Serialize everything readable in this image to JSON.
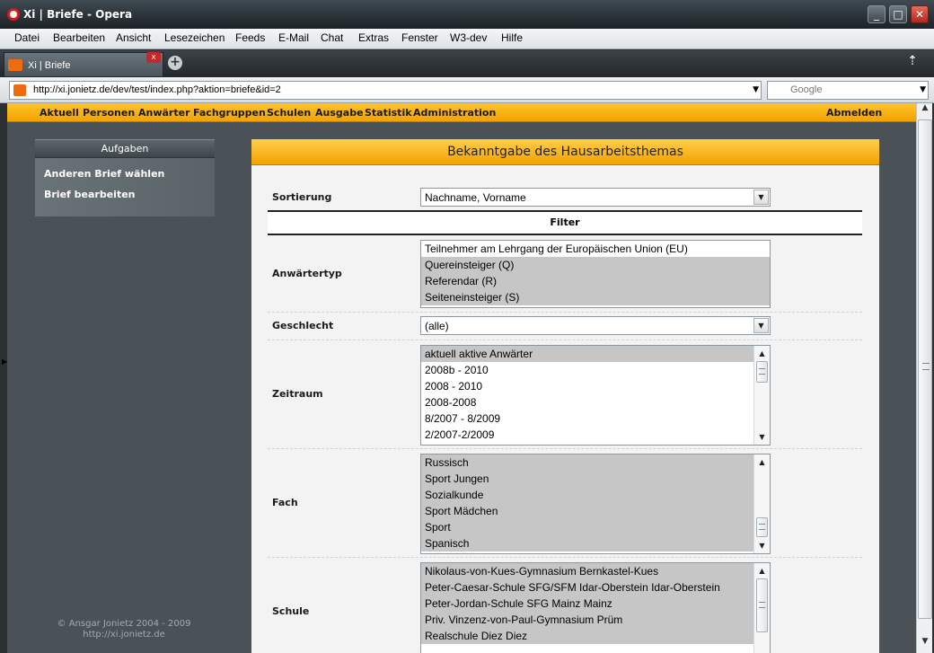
{
  "window": {
    "title": "Xi | Briefe - Opera"
  },
  "menu": [
    "Datei",
    "Bearbeiten",
    "Ansicht",
    "Lesezeichen",
    "Feeds",
    "E-Mail",
    "Chat",
    "Extras",
    "Fenster",
    "W3-dev",
    "Hilfe"
  ],
  "tab": {
    "title": "Xi | Briefe"
  },
  "address": {
    "url": "http://xi.jonietz.de/dev/test/index.php?aktion=briefe&id=2",
    "search_placeholder": "Google"
  },
  "nav": {
    "items": [
      "Aktuell",
      "Personen",
      "Anwärter",
      "Fachgruppen",
      "Schulen",
      "Ausgabe",
      "Statistik",
      "Administration"
    ],
    "logout": "Abmelden"
  },
  "sidebar": {
    "title": "Aufgaben",
    "links": [
      "Anderen Brief wählen",
      "Brief bearbeiten"
    ]
  },
  "footer": {
    "line1": "© Ansgar Jonietz 2004 - 2009",
    "line2": "http://xi.jonietz.de"
  },
  "main": {
    "title": "Bekanntgabe des Hausarbeitsthemas",
    "sort_label": "Sortierung",
    "sort_value": "Nachname, Vorname",
    "filter_heading": "Filter",
    "anwaerter": {
      "label": "Anwärtertyp",
      "options": [
        {
          "text": "Teilnehmer am Lehrgang der Europäischen Union (EU)",
          "selected": false
        },
        {
          "text": "Quereinsteiger (Q)",
          "selected": true
        },
        {
          "text": "Referendar (R)",
          "selected": true
        },
        {
          "text": "Seiteneinsteiger (S)",
          "selected": true
        }
      ]
    },
    "geschlecht": {
      "label": "Geschlecht",
      "value": "(alle)"
    },
    "zeitraum": {
      "label": "Zeitraum",
      "options": [
        {
          "text": "aktuell aktive Anwärter",
          "selected": true
        },
        {
          "text": "2008b - 2010",
          "selected": false
        },
        {
          "text": "2008 - 2010",
          "selected": false
        },
        {
          "text": "2008-2008",
          "selected": false
        },
        {
          "text": "8/2007 - 8/2009",
          "selected": false
        },
        {
          "text": "2/2007-2/2009",
          "selected": false
        }
      ]
    },
    "fach": {
      "label": "Fach",
      "options": [
        {
          "text": "Russisch",
          "selected": true
        },
        {
          "text": "Sport Jungen",
          "selected": true
        },
        {
          "text": "Sozialkunde",
          "selected": true
        },
        {
          "text": "Sport Mädchen",
          "selected": true
        },
        {
          "text": "Sport",
          "selected": true
        },
        {
          "text": "Spanisch",
          "selected": true
        }
      ]
    },
    "schule": {
      "label": "Schule",
      "options": [
        {
          "text": "Nikolaus-von-Kues-Gymnasium Bernkastel-Kues",
          "selected": true
        },
        {
          "text": "Peter-Caesar-Schule SFG/SFM Idar-Oberstein Idar-Oberstein",
          "selected": true
        },
        {
          "text": "Peter-Jordan-Schule SFG Mainz Mainz",
          "selected": true
        },
        {
          "text": "Priv. Vinzenz-von-Paul-Gymnasium Prüm",
          "selected": true
        },
        {
          "text": "Realschule Diez Diez",
          "selected": true
        }
      ]
    }
  }
}
